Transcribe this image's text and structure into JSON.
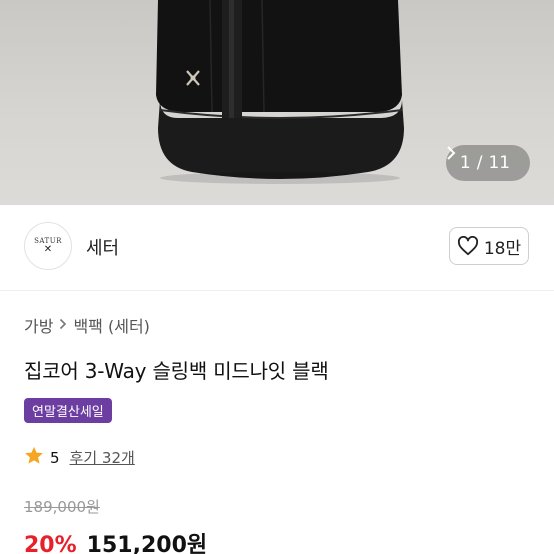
{
  "gallery": {
    "pager_current": "1",
    "pager_separator": "/",
    "pager_total": "11",
    "next_icon": "chevron-right-icon"
  },
  "brand": {
    "logo_text": "SATUR",
    "logo_mark": "✕",
    "name": "세터",
    "like_icon": "heart-outline-icon",
    "like_count": "18만"
  },
  "product": {
    "breadcrumb": [
      "가방",
      "백팩 (세터)"
    ],
    "breadcrumb_separator_icon": "chevron-right-icon",
    "title": "집코어 3-Way 슬링백 미드나잇 블랙",
    "badge": "연말결산세일",
    "badge_color": "#6c3ea2",
    "rating_icon": "star-icon",
    "rating_color": "#f5a623",
    "rating_score": "5",
    "reviews": "후기 32개",
    "original_price": "189,000원",
    "discount": "20%",
    "discount_color": "#e8202a",
    "sale_price": "151,200원"
  }
}
